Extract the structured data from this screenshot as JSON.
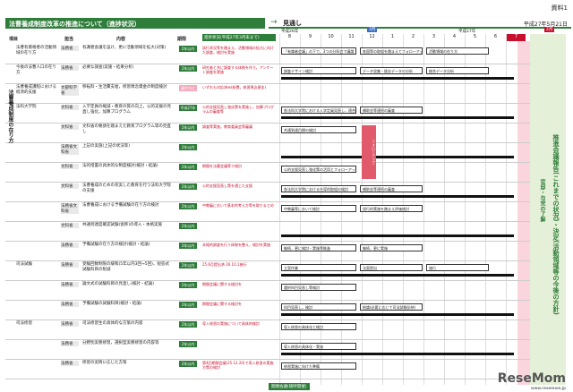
{
  "doc_ref": "資料1",
  "title": "法曹養成制度改革の推進について（進捗状況）",
  "outlook": {
    "arrow": "→",
    "label": "見通し",
    "date": "平成27年5月21日"
  },
  "headers": {
    "item": "項目",
    "owner": "担当",
    "content": "内容",
    "deadline": "期限",
    "status": "進捗状況(平成27年3月末まで)"
  },
  "years": {
    "h26": "平成26年",
    "h27": "平成27年",
    "h27_badge": "3月",
    "h28_badge": "2月"
  },
  "months": [
    "8",
    "9",
    "10",
    "11",
    "12",
    "1",
    "2",
    "3",
    "4",
    "5",
    "6",
    "7"
  ],
  "rows": [
    {
      "item": "法曹有資格者の活動領域の在り方",
      "dept": "法務省",
      "content": "有識者会議を設け，更に活動領域を拡大(対策)",
      "badge": "2年以内",
      "status": "試行状況等を踏まえ，活動領域の拡大に向けた調査，検討を実施",
      "bar1": "「有識者会議」の下で，3つの分科会で議論",
      "bar2": "各国等の取組を踏まえてフォローアップ",
      "bar3": "活動領域の在り方"
    },
    {
      "item": "今後の法曹人口の在り方",
      "dept": "法務省",
      "content": "必要な調査(実施・結果分析)",
      "badge": "2年以内",
      "status": "研究者と共に調査する体制を作り，アンケート調査を実施",
      "bar1": "調査デザイン検討",
      "bar2": "データ収集・既存データの分析",
      "bar3": "総合データ分析"
    },
    {
      "item": "法曹養成課程における経済的支援",
      "dept": "文部科学省",
      "content": "移転料・生活費支給，修習専念資金の制度検討",
      "badge": "速やかに",
      "status": "いずれも対応済み(給費，修習専念資金)",
      "bar1": "",
      "bar2": "",
      "bar3": ""
    },
    {
      "item": "法科大学院",
      "dept": "文科省",
      "content": "入学定員の縮減・教育の質の向上，公的支援の見直し強化，加算プログラム",
      "badge": "平成27年度まで",
      "status": "公的支援見直し強化策を実施し，加算プログラムの審査等",
      "bar1": "各法科大学院における入学定員見直し，適合・連携，体制戦略",
      "bar2": "補助金等連続の審査",
      "bar3": ""
    },
    {
      "item": "",
      "dept": "文科省",
      "content": "文科省の要請を踏まえた教育プログラム等の見直し",
      "badge": "2年以内",
      "status": "調査等実施，教育委員会等審議",
      "bar1": "共通到達目標の検討",
      "bar2": "",
      "bar3": ""
    },
    {
      "item": "",
      "dept": "法務省文科省",
      "content": "上記の実施(上記の状況等)",
      "badge": "2年以内",
      "status": "",
      "bar1": "",
      "bar2": "",
      "bar3": ""
    },
    {
      "item": "",
      "dept": "文科省",
      "content": "法的措置の具体的な制度検討(検討・結論)",
      "badge": "2年以内",
      "status": "期間を法曹会議等で検討",
      "bar1": "公的支援見直し強化策の活用とフォローアップ，具体的措置の在り方",
      "bar2": "",
      "bar3": ""
    },
    {
      "item": "",
      "dept": "文科省",
      "content": "法曹養成のための充実した教育を行う法科大学院の支援",
      "badge": "2年以内",
      "status": "公的支援見直し策を通じた支援",
      "bar1": "各法科大学院における先導的取組の検討",
      "bar2": "補助金等連続の審査",
      "bar3": ""
    },
    {
      "item": "",
      "dept": "法務省文科省",
      "content": "法曹養成における予備試験の在り方の検討",
      "badge": "2年以内",
      "status": "中教審において基本的考え方等を取りまとめ",
      "bar1": "中教審等において検討",
      "bar2": "試行的実施を踏まえ評価検討",
      "bar3": ""
    },
    {
      "item": "",
      "dept": "文科省",
      "content": "共通到達度確認試験(仮称)の導入・本格実施",
      "badge": "2年以内",
      "status": "",
      "bar1": "",
      "bar2": "",
      "bar3": ""
    },
    {
      "item": "",
      "dept": "法務省",
      "content": "予備試験の在り方の検討(検討・結論)",
      "badge": "2年以内",
      "status": "本格的調査を行う体制を整え，検討を実施",
      "bar1": "継続，更に検討・実施等推進",
      "bar2": "継続，更に実施",
      "bar3": ""
    },
    {
      "item": "司法試験",
      "dept": "法務省",
      "content": "受験回数制限の緩和(5年以内3回→5回)，短答式試験科目の削減",
      "badge": "2年以内",
      "status": "25.6月提出済 26.10.1施行",
      "bar1": "立案作業",
      "bar2": "法案提出",
      "bar3": "施行"
    },
    {
      "item": "",
      "dept": "法務省",
      "content": "論文式の試験科目の見直し(検討・結論)",
      "badge": "2年以内",
      "status": "期間会議に関する検討を",
      "bar1": "選択科目見直し等検討",
      "bar2": "",
      "bar3": ""
    },
    {
      "item": "",
      "dept": "法務省",
      "content": "予備試験の試験科目(検討・結論)",
      "badge": "2年以内",
      "status": "期間会議に関する検討を",
      "bar1": "科目見直し，検討",
      "bar2": "結論(必要に応じて司法試験反映)",
      "bar3": ""
    },
    {
      "item": "司法修習",
      "dept": "法務省",
      "content": "司法修習生の具体的な方策の内容",
      "badge": "2年以内",
      "status": "導入修習の実施について具体的検討",
      "bar1": "導入修習の具体化と検討",
      "bar2": "",
      "bar3": ""
    },
    {
      "item": "",
      "dept": "法務省",
      "content": "分野別実務修習，選択型実務修習の内容等",
      "badge": "2年以内",
      "status": "",
      "bar1": "導入修習の具体化・実施",
      "bar2": "",
      "bar3": ""
    },
    {
      "item": "",
      "dept": "法務省",
      "content": "修習の実情に応じた方策",
      "badge": "2年以内",
      "status": "第4回期間会議(25.12.20)で導入修習の実施方策の検討",
      "bar1": "修習実施に向けた準備",
      "bar2": "",
      "bar3": ""
    }
  ],
  "side_label": "法曹養成制度の在り方",
  "vertical_big": "推進会議報告(これまでの状況)・決定(活動領域等の今後の方針)",
  "vertical_small": "官邸・与党の了解",
  "red_arrow": "フォローアップ",
  "footer": "期間会議(随時開催)",
  "logo": "ReseMom",
  "logo_sub": "www.resemom.jp"
}
